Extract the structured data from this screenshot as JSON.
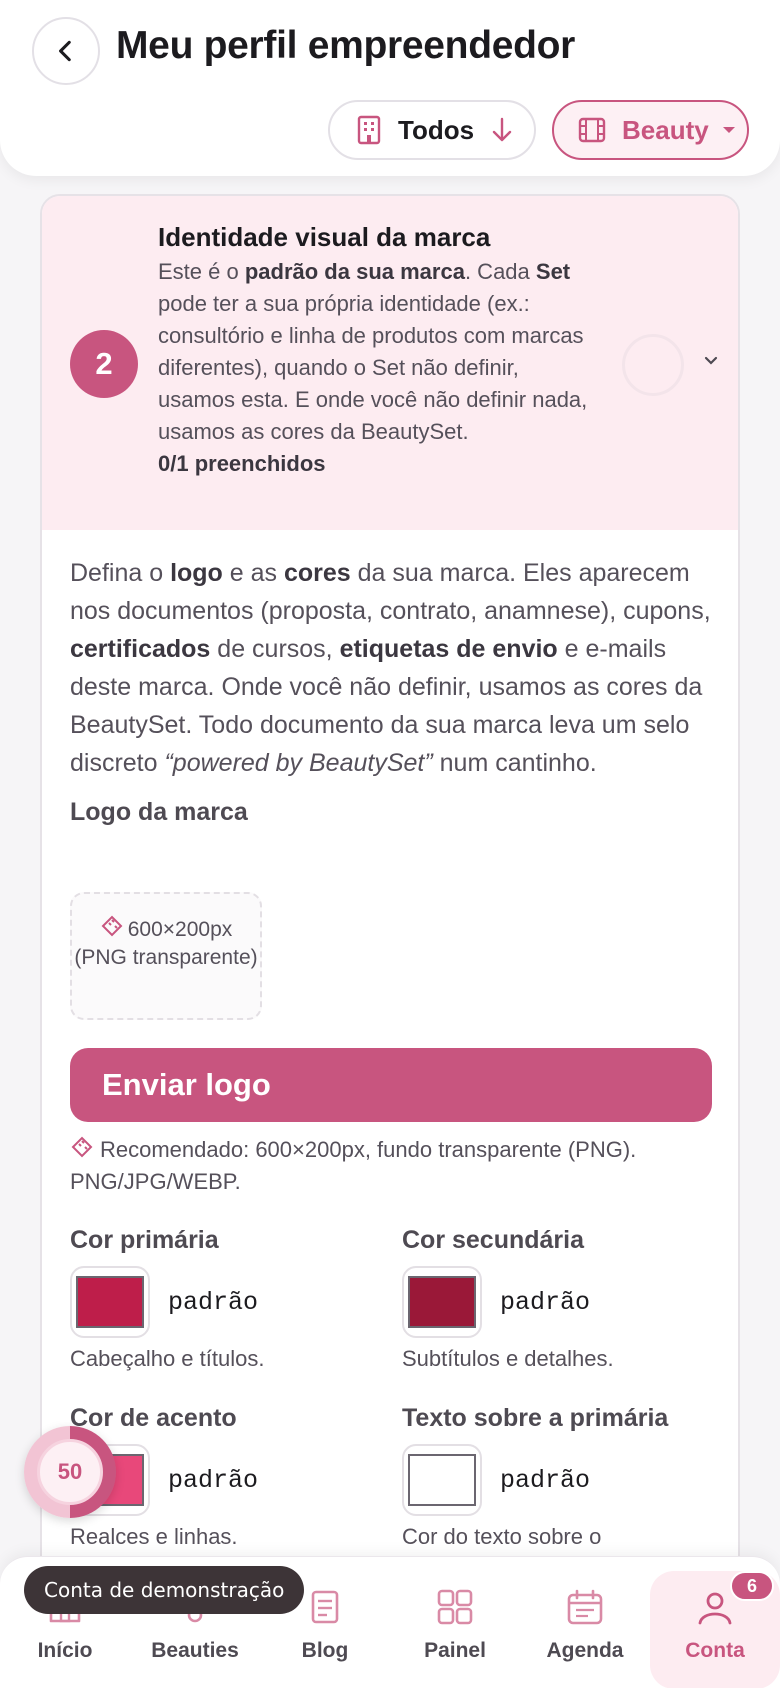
{
  "header": {
    "title": "Meu perfil empreendedor",
    "filter_all": "Todos",
    "filter_brand": "Beauty"
  },
  "section": {
    "step": "2",
    "title": "Identidade visual da marca",
    "desc_1": "Este é o ",
    "desc_b1": "padrão da sua marca",
    "desc_2": ". Cada ",
    "desc_b2": "Set",
    "desc_3": " pode ter a sua própria identidade (ex.: consultório e linha de produtos com marcas diferentes), quando o Set não definir, usamos esta. E onde você não definir nada, usamos as cores da BeautySet.",
    "progress": "0/1 preenchidos"
  },
  "intro": {
    "p1": "Defina o ",
    "b1": "logo",
    "p2": " e as ",
    "b2": "cores",
    "p3": " da sua marca. Eles aparecem nos documentos (proposta, contrato, anamnese), cupons, ",
    "b3": "certificados",
    "p4": " de cursos, ",
    "b4": "etiquetas de envio",
    "p5": " e e-mails deste marca. Onde você não definir, usamos as cores da BeautySet. Todo documento da sua marca leva um selo discreto ",
    "i1": "“powered by BeautySet”",
    "p6": " num cantinho."
  },
  "logo": {
    "label": "Logo da marca",
    "placeholder": "600×200px (PNG transparente)",
    "upload_label": "Enviar logo",
    "hint": "Recomendado: 600×200px, fundo transparente (PNG). PNG/JPG/WEBP."
  },
  "colors": [
    {
      "label": "Cor primária",
      "value": "padrão",
      "help": "Cabeçalho e títulos.",
      "swatch": "#be1e4a"
    },
    {
      "label": "Cor secundária",
      "value": "padrão",
      "help": "Subtítulos e detalhes.",
      "swatch": "#9a1838"
    },
    {
      "label": "Cor de acento",
      "value": "padrão",
      "help": "Realces e linhas.",
      "swatch": "#e8487a"
    },
    {
      "label": "Texto sobre a primária",
      "value": "padrão",
      "help": "Cor do texto sobre o",
      "swatch": "#ffffff"
    }
  ],
  "score": "50",
  "demo_toast": "Conta de demonstração",
  "nav": [
    {
      "label": "Início",
      "icon": "home-icon"
    },
    {
      "label": "Beauties",
      "icon": "beauties-icon"
    },
    {
      "label": "Blog",
      "icon": "blog-icon"
    },
    {
      "label": "Painel",
      "icon": "grid-icon"
    },
    {
      "label": "Agenda",
      "icon": "calendar-icon"
    },
    {
      "label": "Conta",
      "icon": "user-icon",
      "badge": "6"
    }
  ],
  "theme": {
    "accent": "#c8557f",
    "accent_soft": "#fdecf1"
  }
}
